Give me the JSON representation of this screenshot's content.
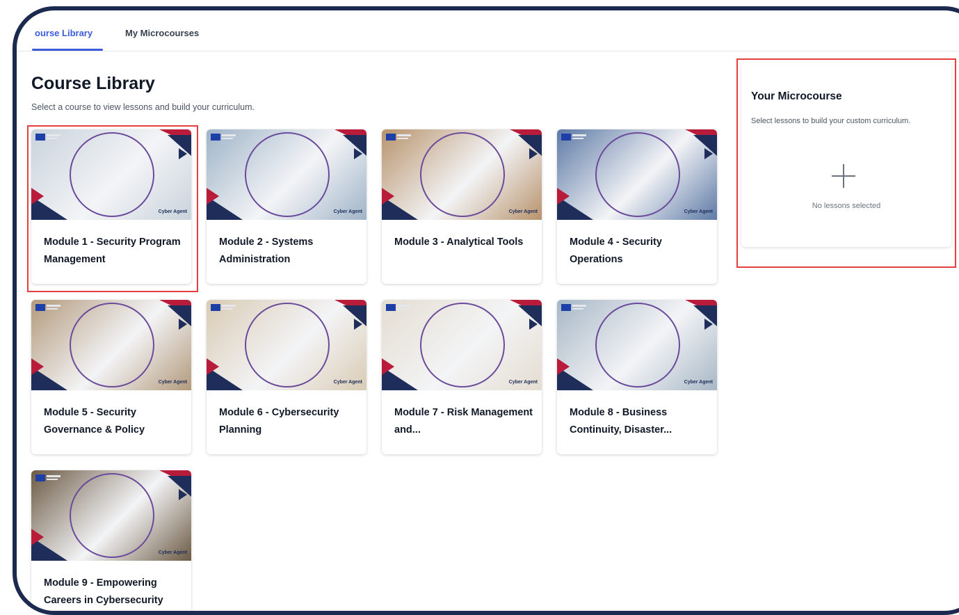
{
  "tabs": [
    {
      "label": "ourse Library",
      "active": true
    },
    {
      "label": "My Microcourses",
      "active": false
    }
  ],
  "page": {
    "title": "Course Library",
    "subtitle": "Select a course to view lessons and build your curriculum."
  },
  "courses": [
    {
      "title": "Module 1 - Security Program Management",
      "brand": "Cyber Agent",
      "theme": "#c9d3dc"
    },
    {
      "title": "Module 2 - Systems Administration",
      "brand": "Cyber Agent",
      "theme": "#9fb4c8"
    },
    {
      "title": "Module 3 - Analytical Tools",
      "brand": "Cyber Agent",
      "theme": "#b8936c"
    },
    {
      "title": "Module 4 - Security Operations",
      "brand": "Cyber Agent",
      "theme": "#5d7aa6"
    },
    {
      "title": "Module 5 - Security Governance & Policy",
      "brand": "Cyber Agent",
      "theme": "#b39a7c"
    },
    {
      "title": "Module 6 - Cybersecurity Planning",
      "brand": "Cyber Agent",
      "theme": "#d9cbb4"
    },
    {
      "title": "Module 7 - Risk Management and...",
      "brand": "Cyber Agent",
      "theme": "#e4ddd1"
    },
    {
      "title": "Module 8 - Business Continuity, Disaster...",
      "brand": "Cyber Agent",
      "theme": "#a7b7c6"
    },
    {
      "title": "Module 9 - Empowering Careers in Cybersecurity",
      "brand": "Cyber Agent",
      "theme": "#6c5a44"
    }
  ],
  "microcourse": {
    "title": "Your Microcourse",
    "subtitle": "Select lessons to build your custom curriculum.",
    "empty": "No lessons selected"
  },
  "colors": {
    "accent": "#3b5bdb",
    "highlight": "#e53e3e",
    "frame": "#1b2a4e"
  }
}
